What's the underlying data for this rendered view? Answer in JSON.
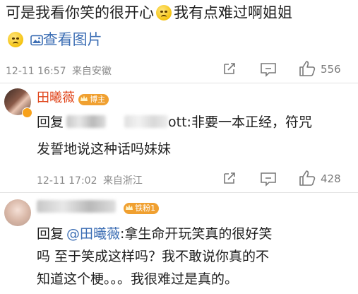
{
  "post": {
    "text_part1": "可是我看你笑的很开心",
    "text_part2": "我有点难过啊姐姐",
    "view_image_label": "查看图片",
    "timestamp": "12-11 16:57",
    "source": "来自安徽",
    "like_count": "556"
  },
  "comment1": {
    "username": "田曦薇",
    "badge": "博主",
    "reply_prefix": "回复",
    "mention_tail": "ott:",
    "line1_text": "非要一本正经，符咒",
    "line2_text": "发誓地说这种话吗妹妹",
    "timestamp": "12-11 17:02",
    "source": "来自浙江",
    "like_count": "428"
  },
  "comment2": {
    "badge": "铁粉1",
    "reply_prefix": "回复",
    "mention": "@田曦薇",
    "line1_text": ":拿生命开玩笑真的很好笑",
    "line2_text": "吗 至于笑成这样吗？我不敢说你真的不",
    "line3_text": "知道这个梗。。。我很难过是真的。"
  },
  "colors": {
    "link": "#3c6eb4",
    "username": "#e0451b",
    "badge": "#f0a030",
    "meta": "#8a8a8a"
  },
  "icons": [
    "emoji-sad-icon",
    "image-icon",
    "share-icon",
    "comment-icon",
    "like-icon",
    "crown-icon"
  ]
}
